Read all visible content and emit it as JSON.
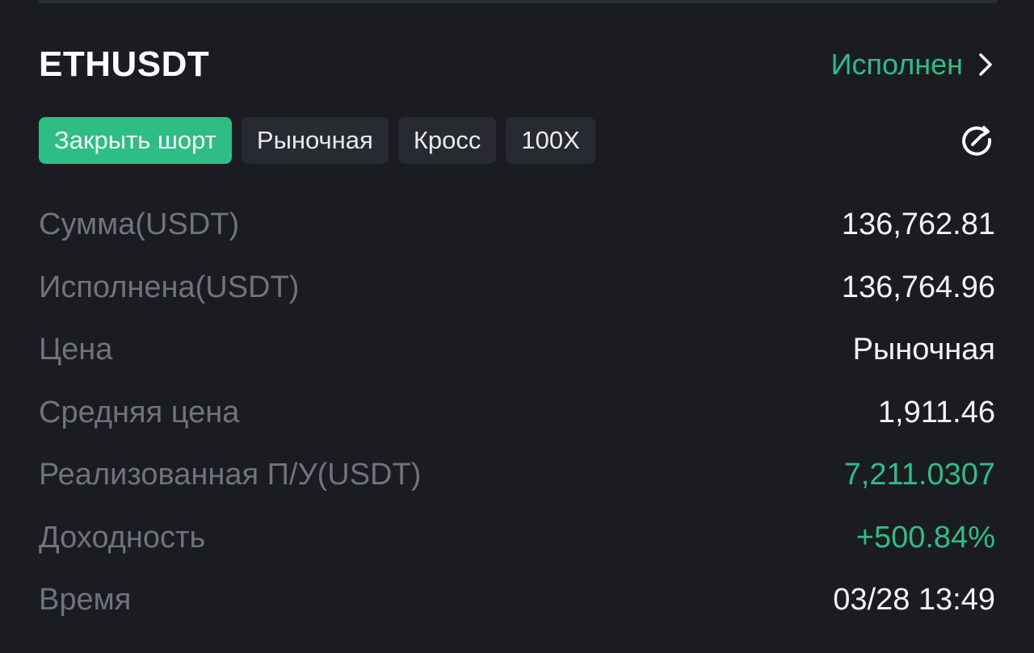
{
  "order": {
    "symbol": "ETHUSDT",
    "status": "Исполнен",
    "status_icon": "chevron-right-icon",
    "share_icon": "share-icon",
    "tags": {
      "side": "Закрыть шорт",
      "type": "Рыночная",
      "margin_mode": "Кросс",
      "leverage": "100X"
    },
    "details": {
      "amount_label": "Сумма(USDT)",
      "amount_value": "136,762.81",
      "filled_label": "Исполнена(USDT)",
      "filled_value": "136,764.96",
      "price_label": "Цена",
      "price_value": "Рыночная",
      "avg_price_label": "Средняя цена",
      "avg_price_value": "1,911.46",
      "realized_pnl_label": "Реализованная П/У(USDT)",
      "realized_pnl_value": "7,211.0307",
      "roi_label": "Доходность",
      "roi_value": "+500.84%",
      "time_label": "Время",
      "time_value": "03/28 13:49"
    }
  },
  "colors": {
    "background": "#1a1c22",
    "accent_green": "#2ebd85",
    "tag_background": "#272a31",
    "label_gray": "#6f737b",
    "value_white": "#f3f4f6"
  }
}
